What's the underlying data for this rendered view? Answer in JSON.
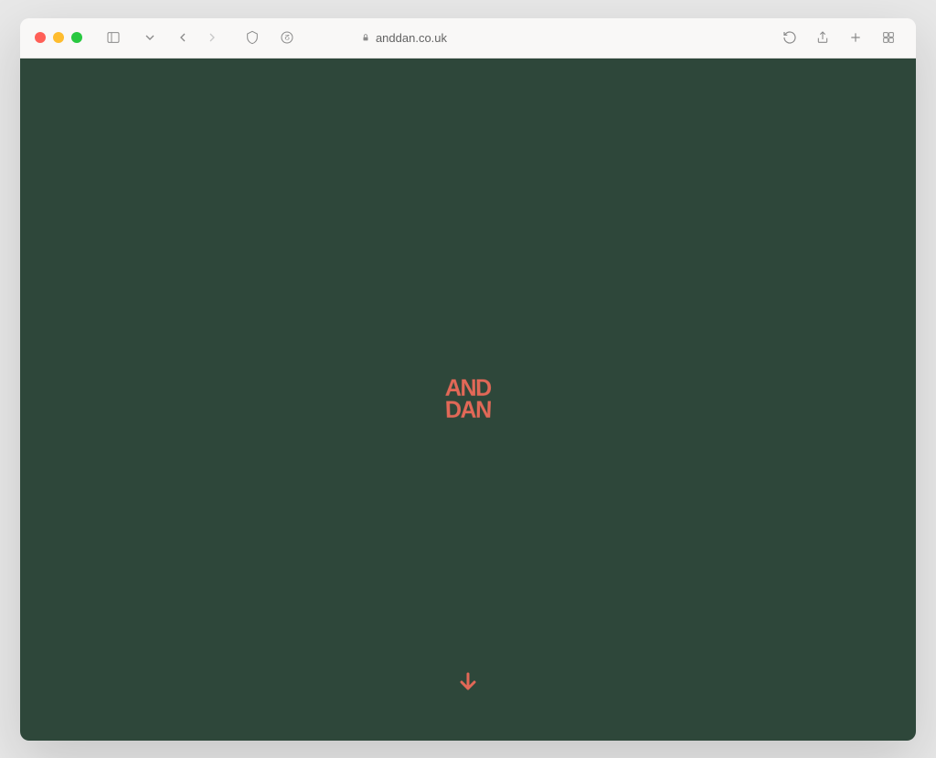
{
  "browser": {
    "url_display": "anddan.co.uk"
  },
  "page": {
    "logo_line1": "AND",
    "logo_line2": "DAN"
  },
  "colors": {
    "page_bg": "#2E473A",
    "accent": "#E26857"
  }
}
